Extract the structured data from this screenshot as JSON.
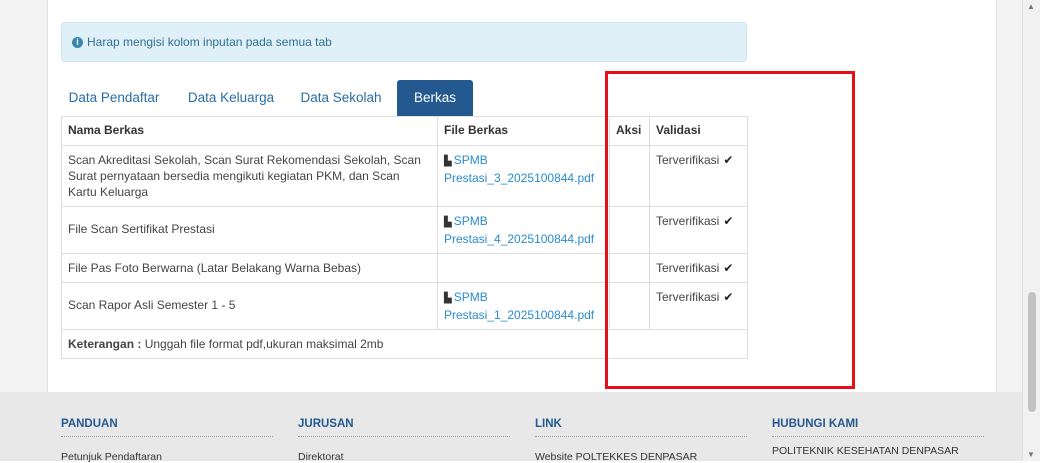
{
  "alert": {
    "icon": "info-icon",
    "text": "Harap mengisi kolom inputan pada semua tab"
  },
  "tabs": [
    {
      "label": "Data Pendaftar",
      "active": false
    },
    {
      "label": "Data Keluarga",
      "active": false
    },
    {
      "label": "Data Sekolah",
      "active": false
    },
    {
      "label": "Berkas",
      "active": true
    }
  ],
  "table": {
    "headers": [
      "Nama Berkas",
      "File Berkas",
      "Aksi",
      "Validasi"
    ],
    "rows": [
      {
        "name": "Scan Akreditasi Sekolah, Scan Surat Rekomendasi Sekolah, Scan Surat pernyataan bersedia mengikuti kegiatan PKM, dan Scan Kartu Keluarga",
        "file_line1": "SPMB",
        "file_line2": "Prestasi_3_2025100844.pdf",
        "aksi": "",
        "validasi": "Terverifikasi"
      },
      {
        "name": "File Scan Sertifikat Prestasi",
        "file_line1": "SPMB",
        "file_line2": "Prestasi_4_2025100844.pdf",
        "aksi": "",
        "validasi": "Terverifikasi"
      },
      {
        "name": "File Pas Foto Berwarna (Latar Belakang Warna Bebas)",
        "file_line1": "",
        "file_line2": "",
        "aksi": "",
        "validasi": "Terverifikasi"
      },
      {
        "name": "Scan Rapor Asli Semester 1 - 5",
        "file_line1": "SPMB",
        "file_line2": "Prestasi_1_2025100844.pdf",
        "aksi": "",
        "validasi": "Terverifikasi"
      }
    ],
    "check_glyph": "✔",
    "file_glyph": "▙"
  },
  "keterangan": {
    "label": "Keterangan :",
    "text": "Unggah file format pdf,ukuran maksimal 2mb"
  },
  "footer": {
    "panduan": {
      "title": "PANDUAN",
      "first_link": "Petunjuk Pendaftaran"
    },
    "jurusan": {
      "title": "JURUSAN",
      "first_link": "Direktorat"
    },
    "link": {
      "title": "LINK",
      "first_link": "Website POLTEKKES DENPASAR"
    },
    "hubungi": {
      "title": "HUBUNGI KAMI",
      "first_link": "POLITEKNIK KESEHATAN DENPASAR"
    }
  },
  "colors": {
    "tab_active_bg": "#23598f",
    "link": "#2a8bcf",
    "highlight_border": "#e3101a",
    "alert_bg": "#dff0f8"
  }
}
